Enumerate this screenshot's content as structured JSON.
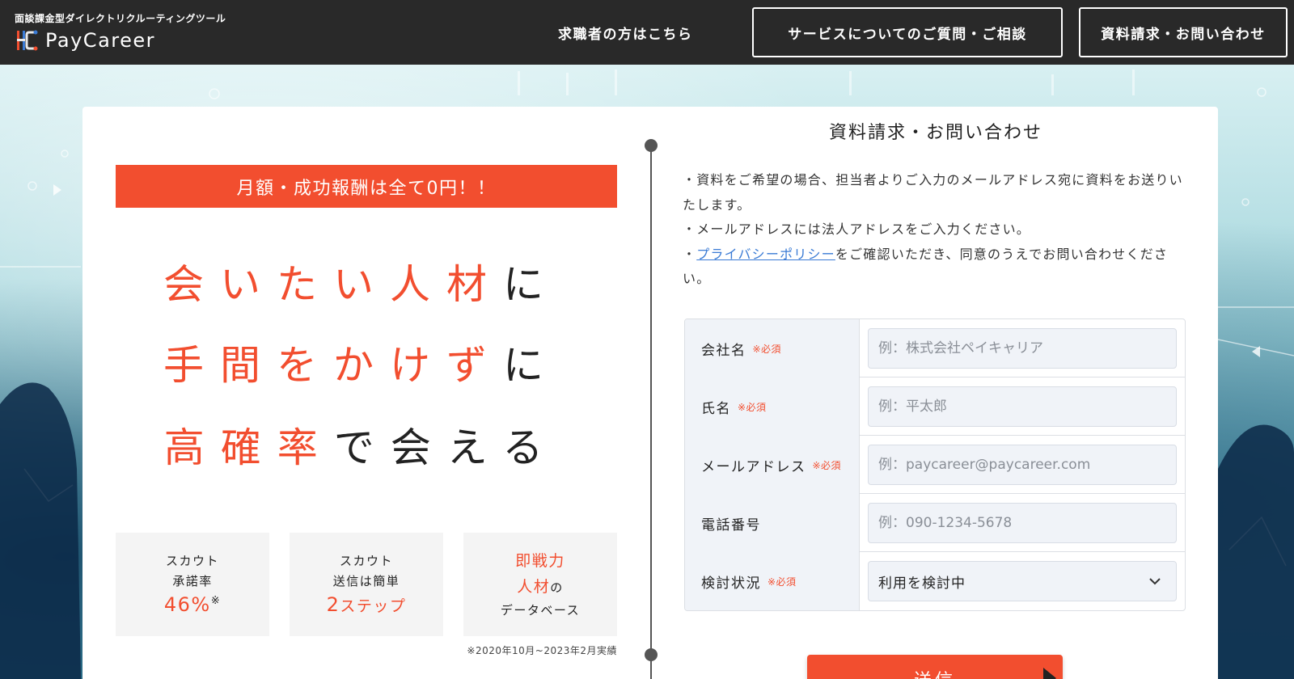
{
  "header": {
    "tagline": "面談課金型ダイレクトリクルーティングツール",
    "logo_text": "PayCareer",
    "nav_jobseeker": "求職者の方はこちら",
    "nav_service": "サービスについてのご質問・ご相談",
    "nav_contact": "資料請求・お問い合わせ"
  },
  "hero": {
    "banner": "月額・成功報酬は全て0円！！",
    "line1_accent": "会いたい人材",
    "line1_rest": "に",
    "line2_accent": "手間をかけず",
    "line2_rest": "に",
    "line3_accent": "高確率",
    "line3_rest": "で会える",
    "stats": [
      {
        "line1": "スカウト",
        "line2": "承諾率",
        "value": "46%",
        "mark": "※"
      },
      {
        "line1": "スカウト",
        "line2": "送信は簡単",
        "value_num": "2",
        "value_text": "ステップ"
      },
      {
        "line1_red": "即戦力",
        "line2_red": "人材",
        "line2_rest": "の",
        "line3": "データベース"
      }
    ],
    "footnote": "※2020年10月~2023年2月実績"
  },
  "form": {
    "title": "資料請求・お問い合わせ",
    "note1": "・資料をご希望の場合、担当者よりご入力のメールアドレス宛に資料をお送りいたします。",
    "note2": "・メールアドレスには法人アドレスをご入力ください。",
    "note3_prefix": "・",
    "note3_link": "プライバシーポリシー",
    "note3_suffix": "をご確認いただき、同意のうえでお問い合わせください。",
    "required_mark": "※必須",
    "fields": [
      {
        "label": "会社名",
        "placeholder": "例：株式会社ペイキャリア",
        "required": true
      },
      {
        "label": "氏名",
        "placeholder": "例：平太郎",
        "required": true
      },
      {
        "label": "メールアドレス",
        "placeholder": "例：paycareer@paycareer.com",
        "required": true
      },
      {
        "label": "電話番号",
        "placeholder": "例：090-1234-5678",
        "required": false
      }
    ],
    "status_label": "検討状況",
    "status_value": "利用を検討中",
    "submit_label": "送信"
  },
  "colors": {
    "accent": "#f24e2f",
    "header_bg": "#292929",
    "link": "#3a7bd5"
  }
}
